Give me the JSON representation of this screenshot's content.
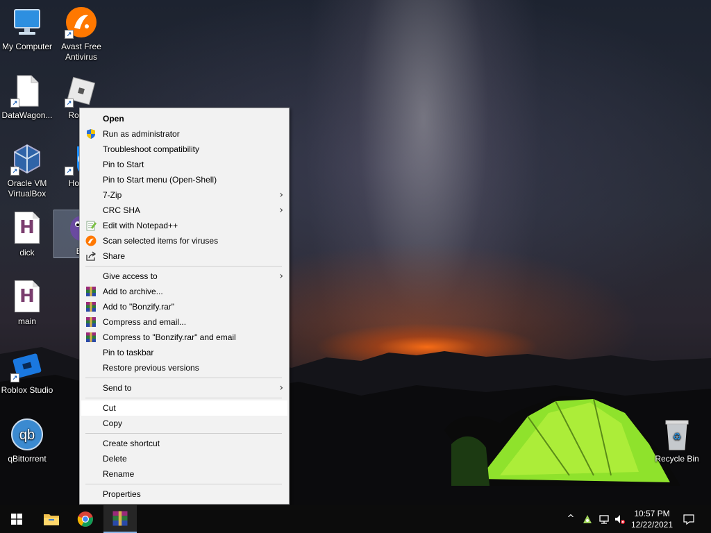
{
  "desktop": {
    "icons": [
      {
        "label": "My Computer"
      },
      {
        "label": "Avast Free Antivirus"
      },
      {
        "label": "DataWagon..."
      },
      {
        "label": "Roblox"
      },
      {
        "label": "Oracle VM VirtualBox"
      },
      {
        "label": "Hot Sh"
      },
      {
        "label": "dick"
      },
      {
        "label": "Bo"
      },
      {
        "label": "main"
      },
      {
        "label": "Roblox Studio"
      },
      {
        "label": "qBittorrent"
      },
      {
        "label": "Recycle Bin"
      }
    ]
  },
  "context_menu": {
    "items": [
      {
        "label": "Open"
      },
      {
        "label": "Run as administrator"
      },
      {
        "label": "Troubleshoot compatibility"
      },
      {
        "label": "Pin to Start"
      },
      {
        "label": "Pin to Start menu (Open-Shell)"
      },
      {
        "label": "7-Zip"
      },
      {
        "label": "CRC SHA"
      },
      {
        "label": "Edit with Notepad++"
      },
      {
        "label": "Scan selected items for viruses"
      },
      {
        "label": "Share"
      },
      {
        "label": "Give access to"
      },
      {
        "label": "Add to archive..."
      },
      {
        "label": "Add to \"Bonzify.rar\""
      },
      {
        "label": "Compress and email..."
      },
      {
        "label": "Compress to \"Bonzify.rar\" and email"
      },
      {
        "label": "Pin to taskbar"
      },
      {
        "label": "Restore previous versions"
      },
      {
        "label": "Send to"
      },
      {
        "label": "Cut"
      },
      {
        "label": "Copy"
      },
      {
        "label": "Create shortcut"
      },
      {
        "label": "Delete"
      },
      {
        "label": "Rename"
      },
      {
        "label": "Properties"
      }
    ],
    "submenu_arrow": "›"
  },
  "taskbar": {
    "time": "10:57 PM",
    "date": "12/22/2021",
    "up_arrow": "^"
  },
  "colors": {
    "menu_bg": "#f2f2f2",
    "taskbar_bg": "#0c0c0c",
    "win_blue": "#1e90ff"
  }
}
